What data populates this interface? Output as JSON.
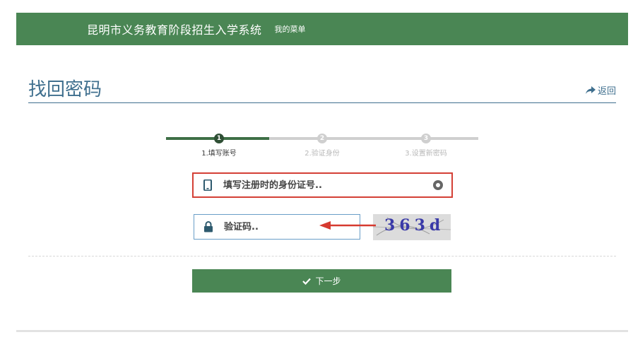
{
  "header": {
    "system_title": "昆明市义务教育阶段招生入学系统",
    "menu_label": "我的菜单"
  },
  "page": {
    "title": "找回密码",
    "back_label": "返回"
  },
  "steps": [
    {
      "number": "1",
      "label": "1.填写账号",
      "state": "active"
    },
    {
      "number": "2",
      "label": "2.验证身份",
      "state": "inactive"
    },
    {
      "number": "3",
      "label": "3.设置新密码",
      "state": "inactive"
    }
  ],
  "form": {
    "id_placeholder": "填写注册时的身份证号..",
    "captcha_placeholder": "验证码..",
    "captcha_image_text": "363d"
  },
  "actions": {
    "next_label": "下一步"
  },
  "colors": {
    "brand_green": "#4a8654",
    "title_blue": "#3f6f8e",
    "highlight_red": "#d44036"
  }
}
